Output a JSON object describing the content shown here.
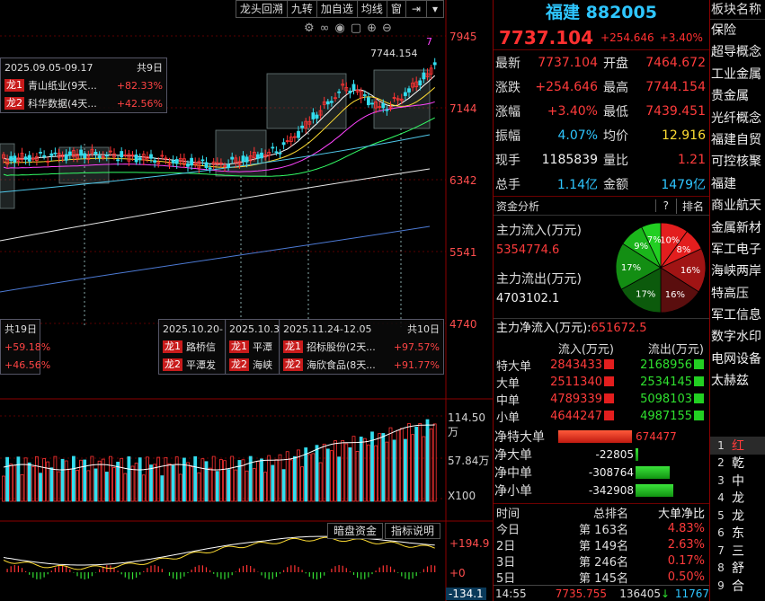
{
  "toolbar": {
    "items": [
      "龙头回溯",
      "九转",
      "加自选",
      "均线",
      "窗"
    ],
    "icons": [
      "pin-icon",
      "chevron-down-icon"
    ]
  },
  "chart_icons": [
    "settings-icon",
    "link-icon",
    "eye-icon",
    "square-icon",
    "plus-icon",
    "minus-icon"
  ],
  "price_axis": [
    "7945",
    "7144",
    "6342",
    "5541",
    "4740"
  ],
  "vol_axis": [
    "114.50万",
    "57.84万",
    "X100"
  ],
  "macd_axis": [
    "+194.9",
    "+0",
    "-134.1"
  ],
  "chart_labels": {
    "high_mark": "7744.154",
    "tick_seven": "7"
  },
  "annotations": [
    {
      "title": "2025.09.05-09.17",
      "count": "共9日",
      "rows": [
        {
          "tag": "龙1",
          "name": "青山纸业(9天...",
          "pct": "+82.33%"
        },
        {
          "tag": "龙2",
          "name": "科华数据(4天...",
          "pct": "+42.56%"
        }
      ]
    },
    {
      "title": "",
      "count": "共19日",
      "rows": [
        {
          "tag": "",
          "name": "",
          "pct": "+59.18%"
        },
        {
          "tag": "",
          "name": "",
          "pct": "+46.56%"
        }
      ]
    },
    {
      "title": "2025.10.20-",
      "count": "",
      "rows": [
        {
          "tag": "龙1",
          "name": "路桥信",
          "pct": ""
        },
        {
          "tag": "龙2",
          "name": "平潭发",
          "pct": ""
        }
      ]
    },
    {
      "title": "2025.10.3",
      "count": "",
      "rows": [
        {
          "tag": "龙1",
          "name": "平潭",
          "pct": ""
        },
        {
          "tag": "龙2",
          "name": "海峡",
          "pct": ""
        }
      ]
    },
    {
      "title": "2025.11.24-12.05",
      "count": "共10日",
      "rows": [
        {
          "tag": "龙1",
          "name": "招标股份(2天...",
          "pct": "+97.57%"
        },
        {
          "tag": "龙2",
          "name": "海欣食品(8天...",
          "pct": "+91.77%"
        }
      ]
    }
  ],
  "sub_toolbar": [
    "暗盘资金",
    "指标说明"
  ],
  "info": {
    "title": "福建 882005",
    "price": "7737.104",
    "change": "+254.646",
    "change_pct": "+3.40%",
    "rows": [
      {
        "k": "最新",
        "v": "7737.104",
        "vc": "red",
        "k2": "开盘",
        "v2": "7464.672",
        "v2c": "red"
      },
      {
        "k": "涨跌",
        "v": "+254.646",
        "vc": "red",
        "k2": "最高",
        "v2": "7744.154",
        "v2c": "red"
      },
      {
        "k": "涨幅",
        "v": "+3.40%",
        "vc": "red",
        "k2": "最低",
        "v2": "7439.451",
        "v2c": "red"
      },
      {
        "k": "振幅",
        "v": "4.07%",
        "vc": "cyan",
        "k2": "均价",
        "v2": "12.916",
        "v2c": "yellow"
      },
      {
        "k": "现手",
        "v": "1185839",
        "vc": "white",
        "k2": "量比",
        "v2": "1.21",
        "v2c": "red"
      },
      {
        "k": "总手",
        "v": "1.14亿",
        "vc": "cyan",
        "k2": "金额",
        "v2": "1479亿",
        "v2c": "cyan"
      }
    ]
  },
  "capital": {
    "header": "资金分析",
    "q": "?",
    "rank_btn": "排名",
    "inflow_label": "主力流入(万元)",
    "inflow_value": "5354774.6",
    "outflow_label": "主力流出(万元)",
    "outflow_value": "4703102.1",
    "net_label": "主力净流入(万元):",
    "net_value": "651672.5"
  },
  "chart_data": {
    "type": "pie",
    "slices": [
      {
        "label": "10%",
        "value": 10,
        "color": "#e31e1e"
      },
      {
        "label": "8%",
        "value": 8,
        "color": "#e31e1e"
      },
      {
        "label": "16%",
        "value": 16,
        "color": "#a01414"
      },
      {
        "label": "16%",
        "value": 16,
        "color": "#5a0e0e"
      },
      {
        "label": "17%",
        "value": 17,
        "color": "#0c5a0c"
      },
      {
        "label": "17%",
        "value": 17,
        "color": "#138e13"
      },
      {
        "label": "9%",
        "value": 9,
        "color": "#1bb51b"
      },
      {
        "label": "7%",
        "value": 7,
        "color": "#22cf22"
      }
    ]
  },
  "order_table": {
    "headers": [
      "",
      "流入(万元)",
      "流出(万元)"
    ],
    "rows": [
      {
        "label": "特大单",
        "in": "2843433",
        "out": "2168956"
      },
      {
        "label": "大单",
        "in": "2511340",
        "out": "2534145"
      },
      {
        "label": "中单",
        "in": "4789339",
        "out": "5098103"
      },
      {
        "label": "小单",
        "in": "4644247",
        "out": "4987155"
      }
    ]
  },
  "net_bars": [
    {
      "label": "净特大单",
      "value": "674477",
      "color": "red",
      "frac": 1.0
    },
    {
      "label": "净大单",
      "value": "-22805",
      "color": "green",
      "frac": 0.04
    },
    {
      "label": "净中单",
      "value": "-308764",
      "color": "green",
      "frac": 0.46
    },
    {
      "label": "净小单",
      "value": "-342908",
      "color": "green",
      "frac": 0.51
    }
  ],
  "rank_table": {
    "headers": [
      "时间",
      "总排名",
      "大单净比"
    ],
    "rows": [
      {
        "t": "今日",
        "r": "第 163名",
        "p": "4.83%"
      },
      {
        "t": "2日",
        "r": "第 149名",
        "p": "2.63%"
      },
      {
        "t": "3日",
        "r": "第 246名",
        "p": "0.17%"
      },
      {
        "t": "5日",
        "r": "第 145名",
        "p": "0.50%"
      }
    ]
  },
  "status": {
    "time": "14:55",
    "price": "7735.755",
    "vol": "136405",
    "extra": "11767"
  },
  "sectors": {
    "header": "板块名称",
    "items": [
      "保险",
      "超导概念",
      "工业金属",
      "贵金属",
      "光纤概念",
      "福建自贸",
      "可控核聚",
      "福建",
      "商业航天",
      "金属新材",
      "军工电子",
      "海峡两岸",
      "特高压",
      "军工信息",
      "数字水印",
      "电网设备",
      "太赫兹"
    ]
  },
  "stock_rank": [
    {
      "no": "1",
      "name": "红"
    },
    {
      "no": "2",
      "name": "乾"
    },
    {
      "no": "3",
      "name": "中"
    },
    {
      "no": "4",
      "name": "龙"
    },
    {
      "no": "5",
      "name": "龙"
    },
    {
      "no": "6",
      "name": "东"
    },
    {
      "no": "7",
      "name": "三"
    },
    {
      "no": "8",
      "name": "舒"
    },
    {
      "no": "9",
      "name": "合"
    }
  ]
}
